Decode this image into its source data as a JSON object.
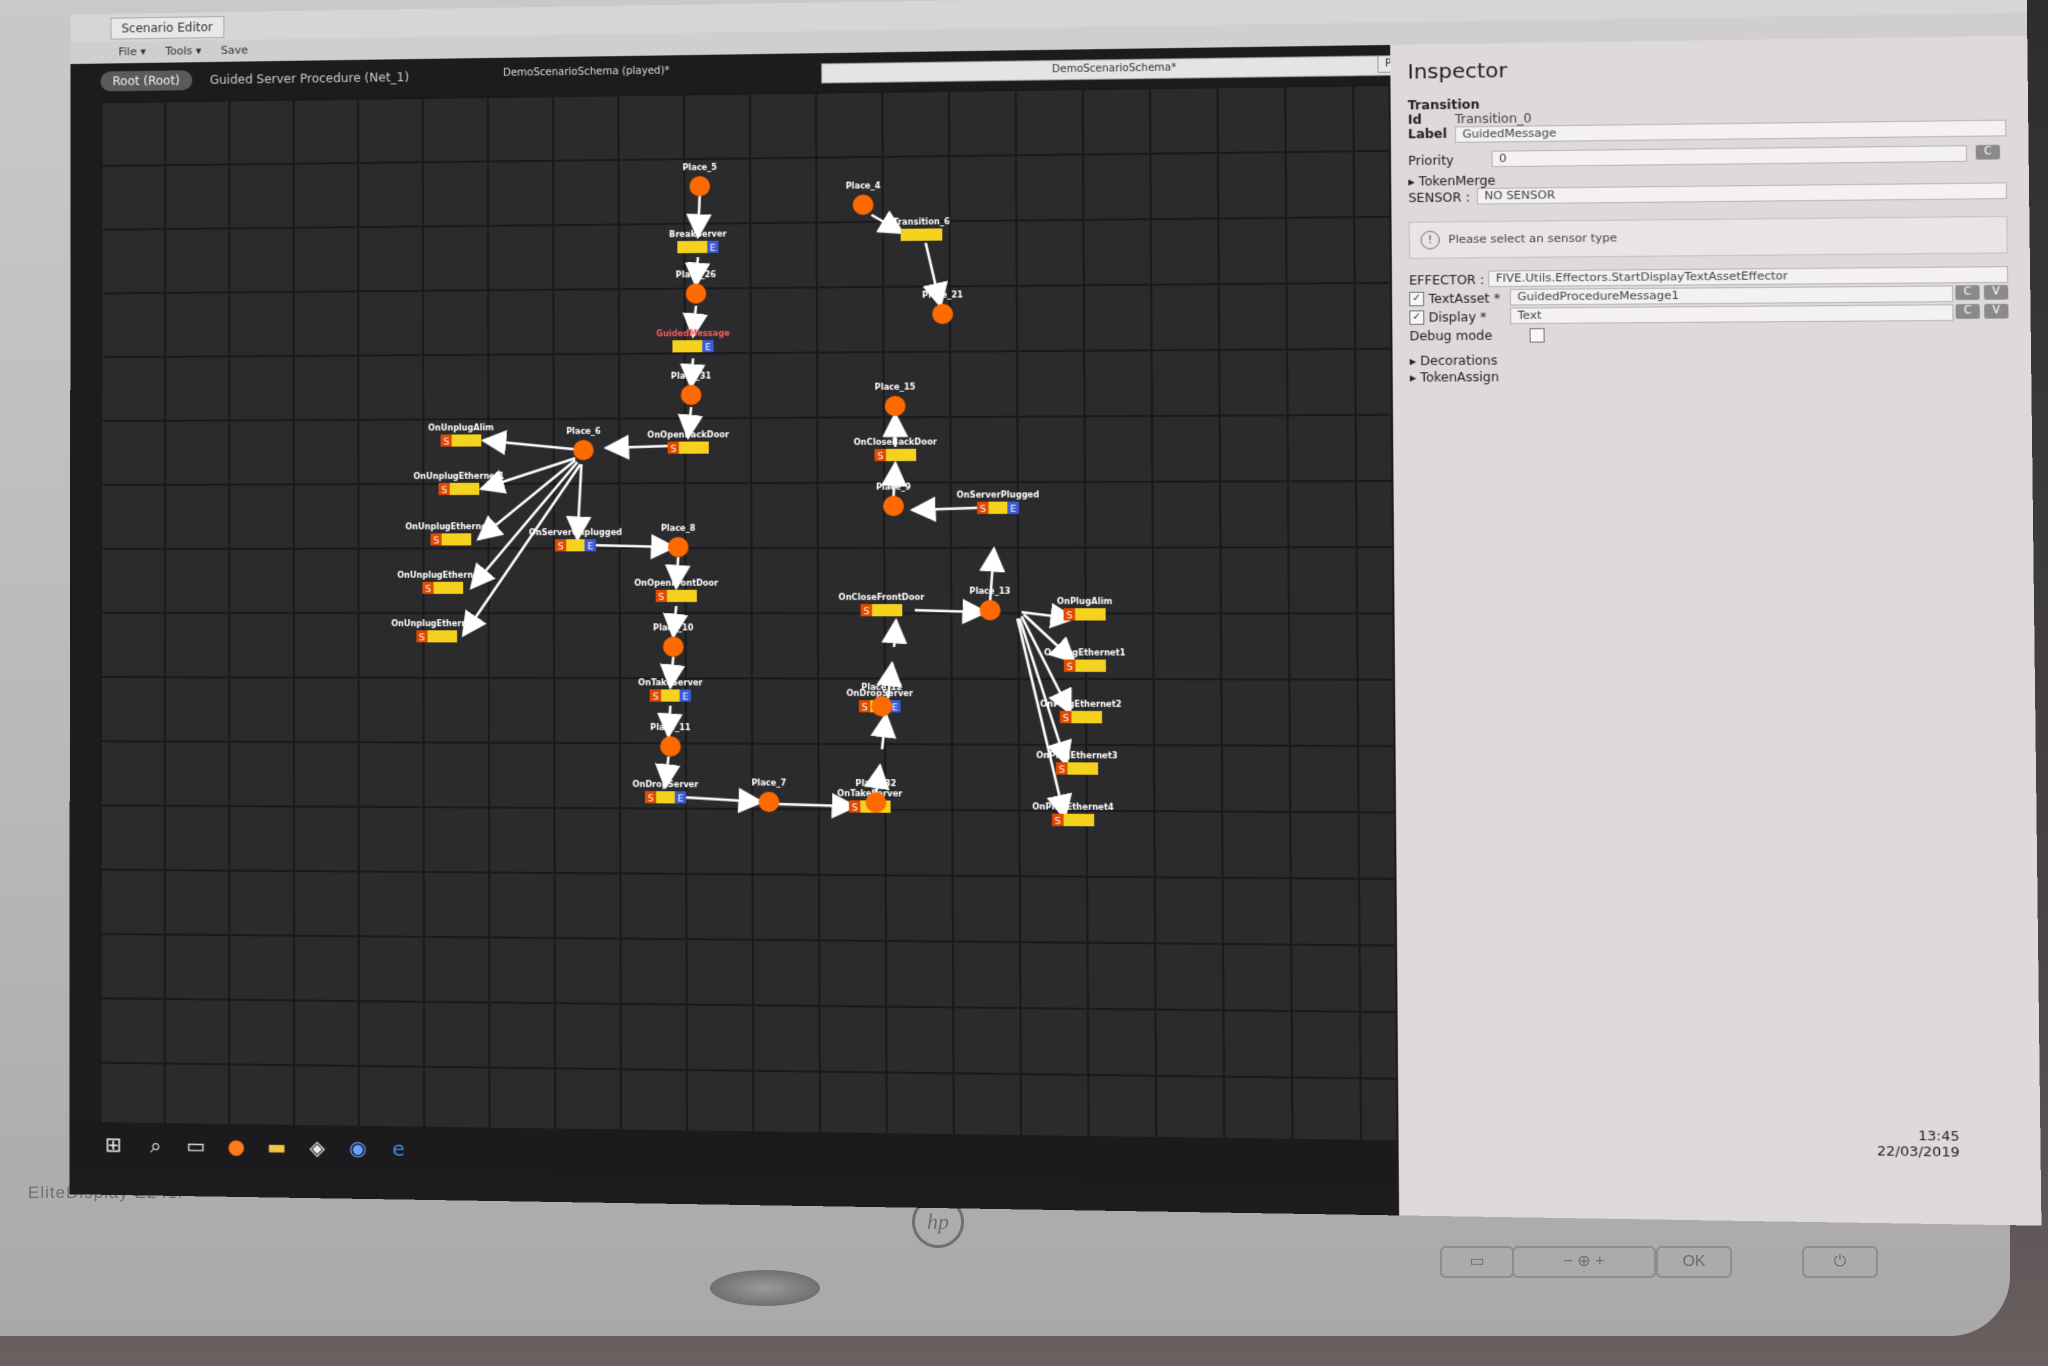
{
  "window": {
    "title": "Scenario Editor",
    "menu": [
      "File ▾",
      "Tools ▾",
      "Save"
    ]
  },
  "breadcrumb": {
    "root": "Root (Root)",
    "current": "Guided Server Procedure (Net_1)"
  },
  "schema": {
    "tab_label": "DemoScenarioSchema (played)*",
    "field_value": "DemoScenarioSchema*",
    "play_mode": "Play Mode"
  },
  "inspector": {
    "title": "Inspector",
    "section": "Transition",
    "id_label": "Id",
    "id_value": "Transition_0",
    "label_label": "Label",
    "label_value": "GuidedMessage",
    "priority_label": "Priority",
    "priority_value": "0",
    "token_merge": "TokenMerge",
    "sensor_label": "SENSOR :",
    "sensor_value": "NO SENSOR",
    "warning": "Please select an sensor type",
    "effector_label": "EFFECTOR :",
    "effector_value": "FIVE.Utils.Effectors.StartDisplayTextAssetEffector",
    "textasset_label": "TextAsset *",
    "textasset_value": "GuidedProcedureMessage1",
    "display_label": "Display *",
    "display_value": "Text",
    "debug_label": "Debug mode",
    "decorations": "Decorations",
    "token_assign": "TokenAssign",
    "btn_c": "C",
    "btn_v": "V"
  },
  "graph": {
    "places": [
      "Place_5",
      "Place_26",
      "Place_31",
      "Place_6",
      "Place_8",
      "Place_10",
      "Place_11",
      "Place_7",
      "Place_32",
      "Place_12",
      "Place_13",
      "Place_9",
      "Place_15",
      "Place_4",
      "Place_21"
    ],
    "transitions": [
      "BreakServer",
      "GuidedMessage",
      "OnOpenBackDoor",
      "OnUnplugAlim",
      "OnUnplugEthernet1",
      "OnUnplugEthernet2",
      "OnUnplugEthernet3",
      "OnUnplugEthernet4",
      "OnServerUnplugged",
      "OnOpenFrontDoor",
      "OnTakeServer",
      "OnDropServer",
      "OnTakeServer",
      "OnDropServer",
      "OnCloseFrontDoor",
      "OnServerPlugged",
      "OnCloseBackDoor",
      "OnPlugAlim",
      "OnPlugEthernet1",
      "OnPlugEthernet2",
      "OnPlugEthernet3",
      "OnPlugEthernet4",
      "Transition_6"
    ],
    "badge_s": "S",
    "badge_e": "E"
  },
  "taskbar": {
    "icons": [
      "windows-start-icon",
      "search-icon",
      "task-view-icon",
      "firefox-icon",
      "file-explorer-icon",
      "unity-icon",
      "chrome-icon",
      "edge-icon"
    ]
  },
  "clock": {
    "time": "13:45",
    "date": "22/03/2019"
  },
  "monitor": {
    "model": "EliteDisplay E241i",
    "brand": "hp"
  },
  "colors": {
    "place": "#ff6a00",
    "transition": "#f5d21e",
    "badge_s": "#e04a00",
    "badge_e": "#3b5bd6",
    "accent_label": "#ff5a5a"
  }
}
